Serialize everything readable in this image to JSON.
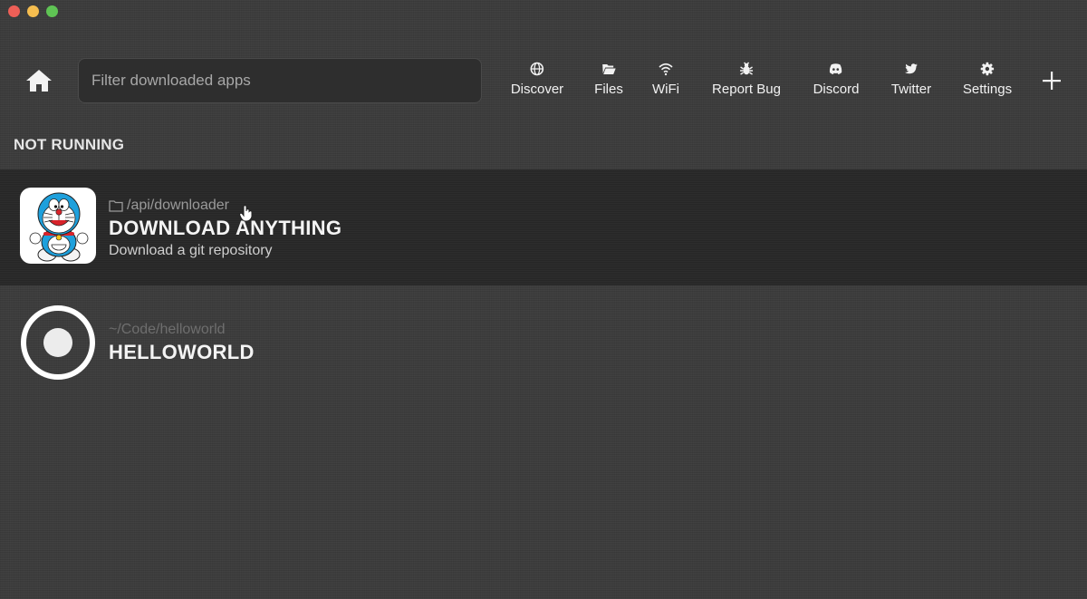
{
  "window": {
    "controls": [
      "close",
      "minimize",
      "maximize"
    ]
  },
  "toolbar": {
    "home_icon": "home-icon",
    "search": {
      "placeholder": "Filter downloaded apps",
      "value": ""
    },
    "nav": [
      {
        "label": "Discover",
        "icon": "globe-icon"
      },
      {
        "label": "Files",
        "icon": "folder-open-icon"
      },
      {
        "label": "WiFi",
        "icon": "wifi-icon"
      },
      {
        "label": "Report Bug",
        "icon": "bug-icon"
      },
      {
        "label": "Discord",
        "icon": "discord-icon"
      },
      {
        "label": "Twitter",
        "icon": "twitter-icon"
      },
      {
        "label": "Settings",
        "icon": "gear-icon"
      }
    ],
    "add_icon": "plus-icon"
  },
  "section": {
    "title": "NOT RUNNING"
  },
  "apps": [
    {
      "path": "/api/downloader",
      "name": "DOWNLOAD ANYTHING",
      "description": "Download a git repository",
      "icon": "doraemon-avatar",
      "selected": true
    },
    {
      "path": "~/Code/helloworld",
      "name": "HELLOWORLD",
      "description": "",
      "icon": "record-circle-icon",
      "selected": false
    }
  ],
  "colors": {
    "background": "#3b3b3b",
    "selected_row": "#262626",
    "close": "#ee5f57",
    "minimize": "#f5bd4f",
    "maximize": "#5fc454"
  }
}
